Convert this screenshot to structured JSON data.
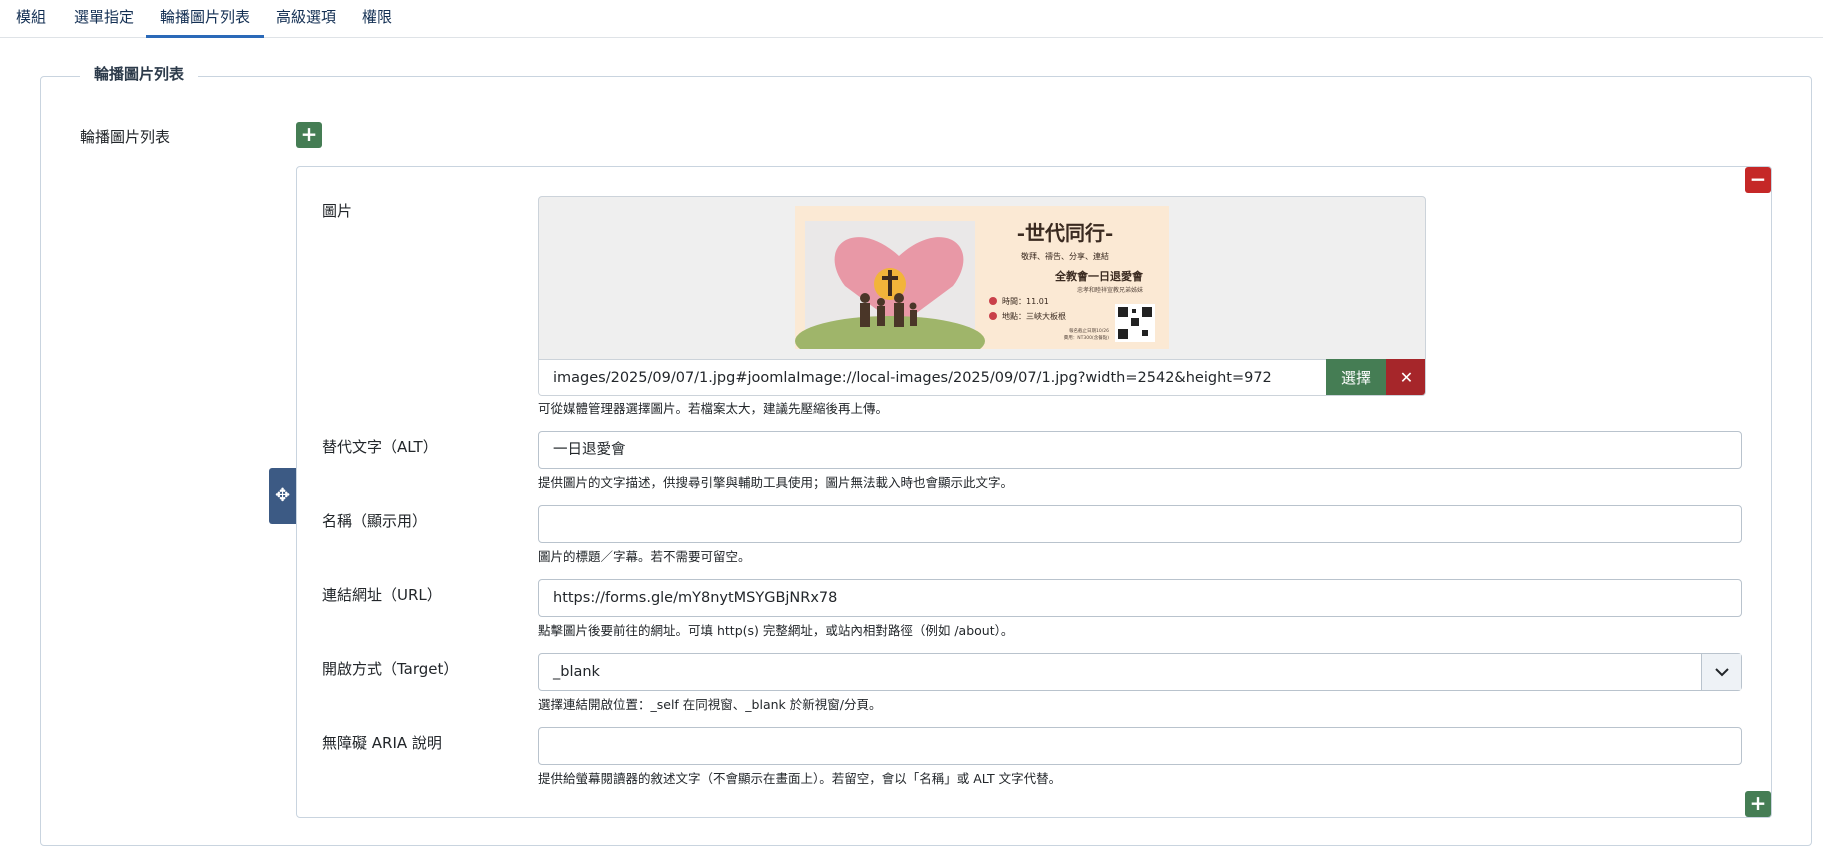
{
  "tabs": [
    "模組",
    "選單指定",
    "輪播圖片列表",
    "高級選項",
    "權限"
  ],
  "active_tab": "輪播圖片列表",
  "fieldset": {
    "legend": "輪播圖片列表",
    "label": "輪播圖片列表"
  },
  "subform": {
    "image": {
      "label": "圖片",
      "value": "images/2025/09/07/1.jpg#joomlaImage://local-images/2025/09/07/1.jpg?width=2542&height=972",
      "select_label": "選擇",
      "hint": "可從媒體管理器選擇圖片。若檔案太大，建議先壓縮後再上傳。",
      "preview": {
        "title": "-世代同行-",
        "subtitle": "敬拜、禱告、分享、連結",
        "event": "全教會一日退愛會",
        "organizer": "忠孝和睦祥宣教兄弟姊妹",
        "time": "時間：11.01",
        "place": "地點：三峽大板根",
        "footnote1": "報名截止日期10/26",
        "footnote2": "費用：NT300(含餐點)"
      }
    },
    "alt": {
      "label": "替代文字（ALT）",
      "value": "一日退愛會",
      "hint": "提供圖片的文字描述，供搜尋引擎與輔助工具使用；圖片無法載入時也會顯示此文字。"
    },
    "caption": {
      "label": "名稱（顯示用）",
      "value": "",
      "hint": "圖片的標題／字幕。若不需要可留空。"
    },
    "url": {
      "label": "連結網址（URL）",
      "value": "https://forms.gle/mY8nytMSYGBjNRx78",
      "hint": "點擊圖片後要前往的網址。可填 http(s) 完整網址，或站內相對路徑（例如 /about）。"
    },
    "target": {
      "label": "開啟方式（Target）",
      "value": "_blank",
      "hint": "選擇連結開啟位置：_self 在同視窗、_blank 於新視窗/分頁。"
    },
    "aria": {
      "label": "無障礙 ARIA 說明",
      "value": "",
      "hint": "提供給螢幕閱讀器的敘述文字（不會顯示在畫面上）。若留空，會以「名稱」或 ALT 文字代替。"
    }
  },
  "colors": {
    "add": "#457d54",
    "remove": "#c52827",
    "drag": "#3c5a84",
    "tab_active": "#2a69b8"
  },
  "icons": [
    "plus-icon",
    "minus-icon",
    "move-icon",
    "close-icon",
    "chevron-down-icon"
  ]
}
